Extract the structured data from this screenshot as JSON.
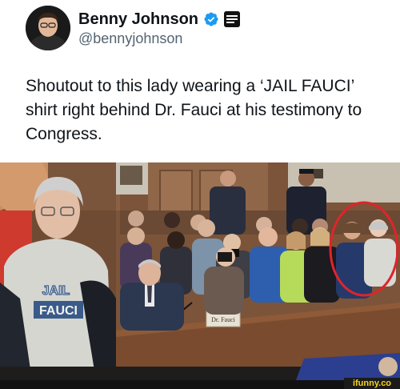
{
  "tweet": {
    "display_name": "Benny Johnson",
    "handle": "@bennyjohnson",
    "text": "Shoutout to this lady wearing a ‘JAIL FAUCI’ shirt right behind Dr. Fauci at his testimony to Congress.",
    "verified_color": "#1d9bf0"
  },
  "photo": {
    "shirt_text_line1": "JAIL",
    "shirt_text_line2": "FAUCI",
    "nameplate_text": "Dr. Fauci",
    "highlight_color": "#e0242a"
  },
  "watermark": {
    "text": "ifunny.co"
  }
}
